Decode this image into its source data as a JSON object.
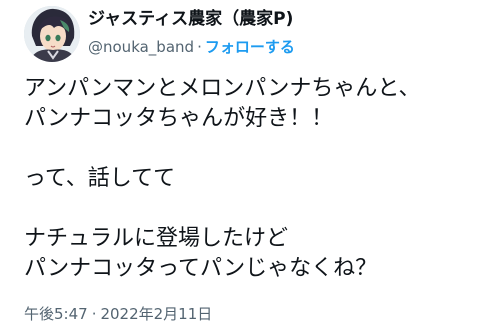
{
  "user": {
    "display_name": "ジャスティス農家（農家P)",
    "handle": "@nouka_band",
    "separator": "·",
    "follow_label": "フォローする"
  },
  "tweet": {
    "text": "アンパンマンとメロンパンナちゃんと、\nパンナコッタちゃんが好き！！\n\nって、話してて\n\nナチュラルに登場したけど\nパンナコッタってパンじゃなくね？",
    "time": "午後5:47",
    "separator": "·",
    "date": "2022年2月11日"
  },
  "colors": {
    "accent": "#1d9bf0",
    "text": "#0f1419",
    "secondary": "#536471"
  }
}
